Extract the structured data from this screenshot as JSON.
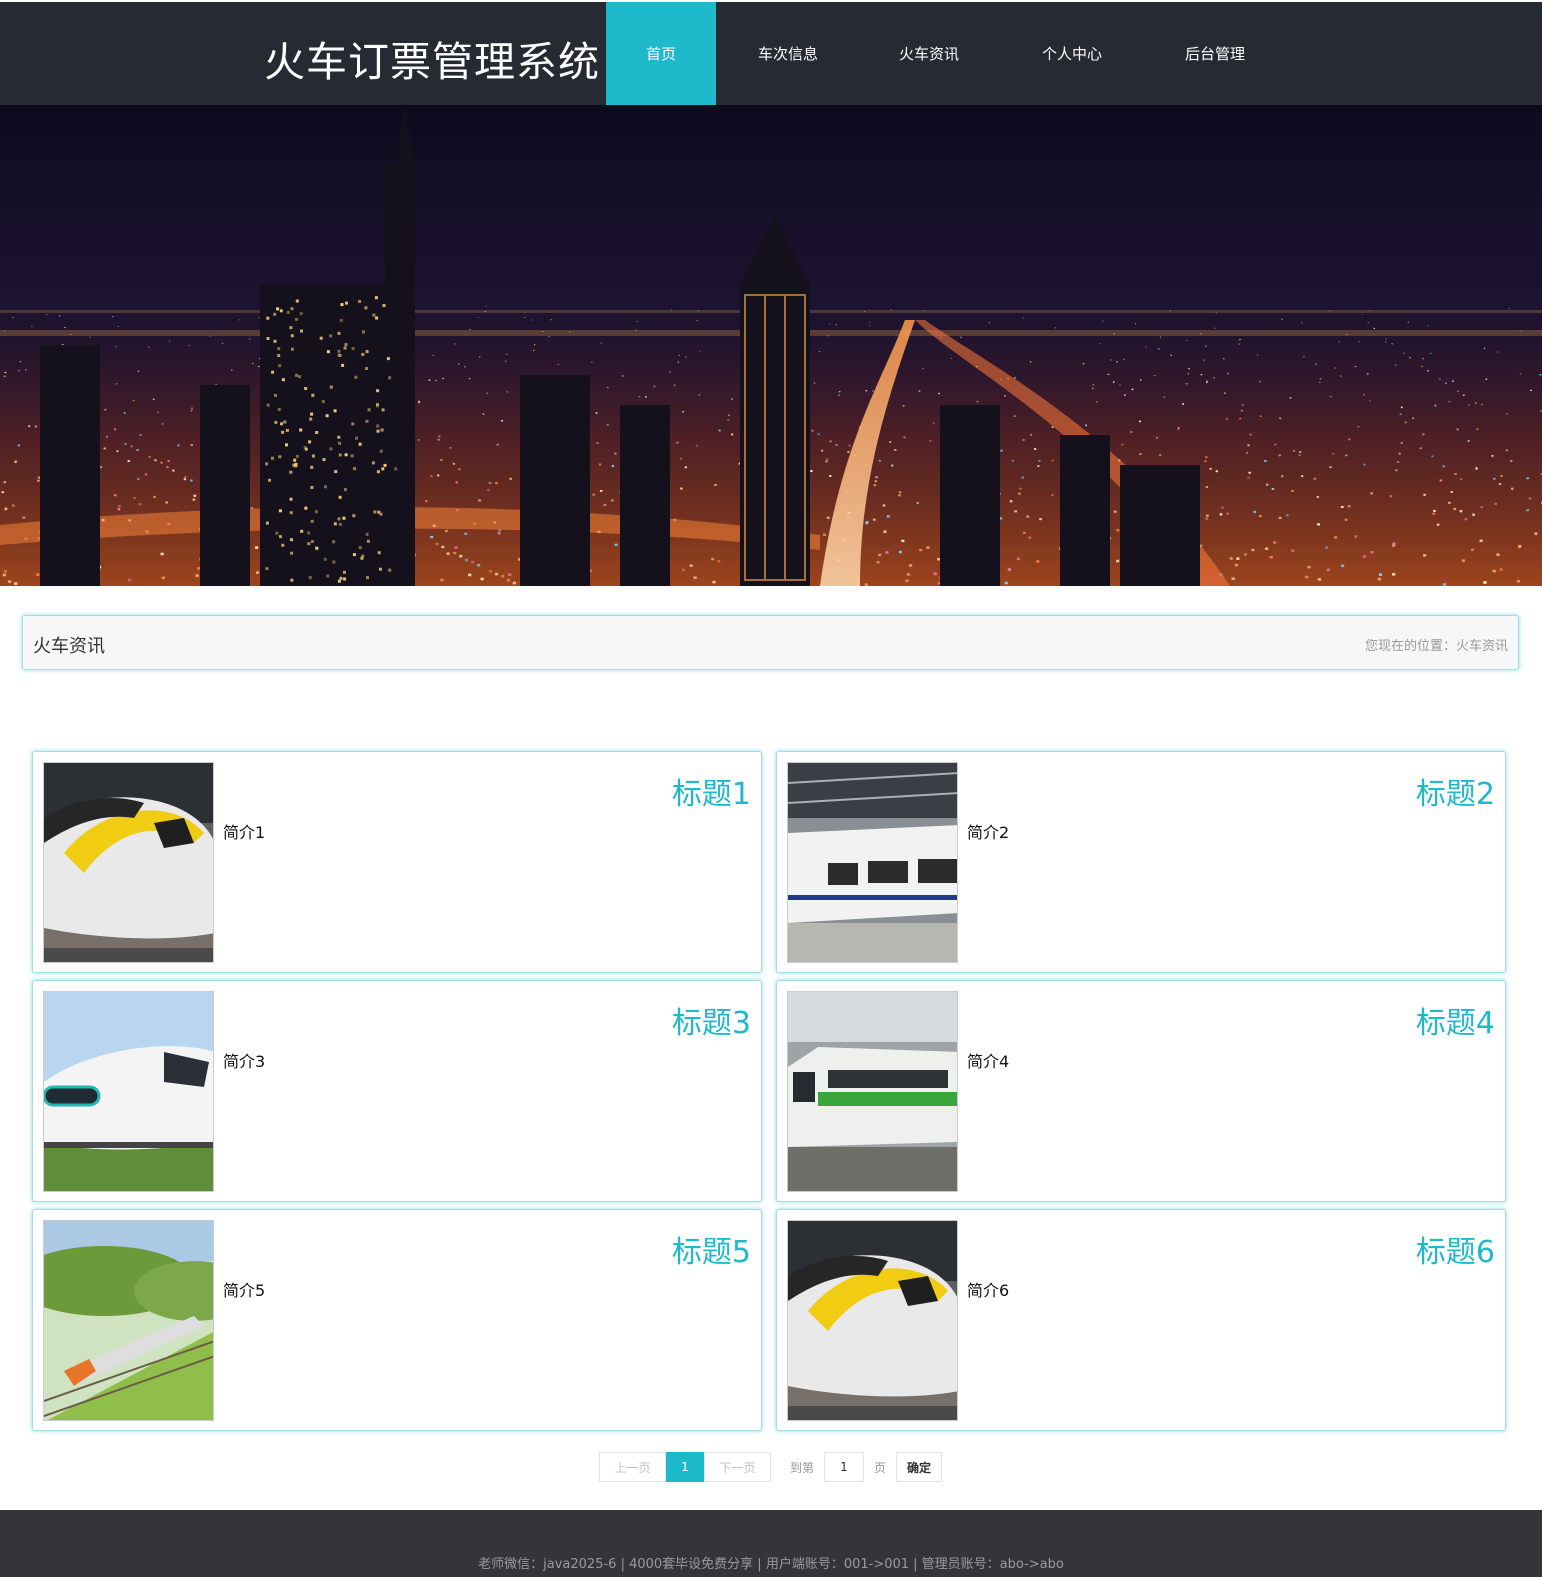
{
  "header": {
    "site_title": "火车订票管理系统",
    "nav": [
      {
        "label": "首页",
        "active": true
      },
      {
        "label": "车次信息",
        "active": false
      },
      {
        "label": "火车资讯",
        "active": false
      },
      {
        "label": "个人中心",
        "active": false
      },
      {
        "label": "后台管理",
        "active": false
      }
    ]
  },
  "banner": {
    "icon": "city-night-skyline-image"
  },
  "section": {
    "title": "火车资讯",
    "location_label": "您现在的位置：",
    "location_value": "火车资讯"
  },
  "news": [
    {
      "title": "标题1",
      "intro": "简介1",
      "image": "yellow-high-speed-train-image"
    },
    {
      "title": "标题2",
      "intro": "简介2",
      "image": "harmony-train-in-station-image"
    },
    {
      "title": "标题3",
      "intro": "简介3",
      "image": "white-bullet-train-image"
    },
    {
      "title": "标题4",
      "intro": "简介4",
      "image": "green-stripe-train-image"
    },
    {
      "title": "标题5",
      "intro": "简介5",
      "image": "train-in-green-field-image"
    },
    {
      "title": "标题6",
      "intro": "简介6",
      "image": "yellow-high-speed-train-image"
    }
  ],
  "pagination": {
    "prev": "上一页",
    "current": "1",
    "next": "下一页",
    "goto_label": "到第",
    "page_input": "1",
    "page_unit": "页",
    "confirm": "确定"
  },
  "footer": {
    "text": "老师微信：java2025-6 | 4000套毕设免费分享 | 用户端账号：001->001 | 管理员账号：abo->abo"
  },
  "colors": {
    "accent": "#1fb9cc",
    "header_bg": "#262a33",
    "footer_bg": "#333539"
  }
}
